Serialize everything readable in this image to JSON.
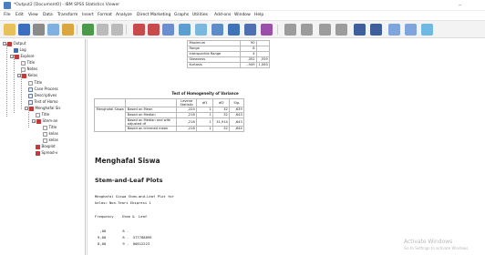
{
  "window": {
    "title": "*Output2 [Document0] - IBM SPSS Statistics Viewer",
    "minimize": "–",
    "maximize": "☐"
  },
  "menu": [
    "File",
    "Edit",
    "View",
    "Data",
    "Transform",
    "Insert",
    "Format",
    "Analyze",
    "Direct Marketing",
    "Graphs",
    "Utilities",
    "Add-ons",
    "Window",
    "Help"
  ],
  "outline": {
    "nodes": [
      {
        "label": "Output",
        "toggle": "−"
      },
      {
        "label": "Log",
        "toggle": ""
      },
      {
        "label": "Explore",
        "toggle": "−"
      },
      {
        "label": "Title",
        "toggle": ""
      },
      {
        "label": "Notes",
        "toggle": ""
      },
      {
        "label": "Kelas",
        "toggle": "−"
      },
      {
        "label": "Title",
        "toggle": ""
      },
      {
        "label": "Case Process",
        "toggle": ""
      },
      {
        "label": "Descriptives",
        "toggle": ""
      },
      {
        "label": "Test of Homo",
        "toggle": ""
      },
      {
        "label": "Menghafal Sis",
        "toggle": "−"
      },
      {
        "label": "Title",
        "toggle": ""
      },
      {
        "label": "Stem-an",
        "toggle": "−"
      },
      {
        "label": "Title",
        "toggle": ""
      },
      {
        "label": "kelas",
        "toggle": ""
      },
      {
        "label": "kelas",
        "toggle": ""
      },
      {
        "label": "Boxplot",
        "toggle": ""
      },
      {
        "label": "Spread-v",
        "toggle": ""
      }
    ]
  },
  "descriptives_tail": {
    "rows": [
      {
        "label": "Maximum",
        "value": "90",
        "se": ""
      },
      {
        "label": "Range",
        "value": "8",
        "se": ""
      },
      {
        "label": "Interquartile Range",
        "value": "4",
        "se": ""
      },
      {
        "label": "Skewness",
        "value": ",352",
        "se": ",559"
      },
      {
        "label": "Kurtosis",
        "value": "-,949",
        "se": "1,063"
      }
    ]
  },
  "homogeneity": {
    "title": "Test of Homogeneity of Variance",
    "headers": [
      "",
      "",
      "Levene Statistic",
      "df1",
      "df2",
      "Sig."
    ],
    "group_label": "Menghafal Siswa",
    "rows": [
      {
        "basis": "Based on Mean",
        "stat": ",224",
        "df1": "1",
        "df2": "32",
        "sig": ",639"
      },
      {
        "basis": "Based on Median",
        "stat": ",218",
        "df1": "1",
        "df2": "32",
        "sig": ",643"
      },
      {
        "basis": "Based on Median and with adjusted df",
        "stat": ",218",
        "df1": "1",
        "df2": "31,914",
        "sig": ",643"
      },
      {
        "basis": "Based on trimmed mean",
        "stat": ",218",
        "df1": "1",
        "df2": "32",
        "sig": ",644"
      }
    ]
  },
  "sections": {
    "menghafal": "Menghafal Siswa",
    "stem_leaf": "Stem-and-Leaf Plots"
  },
  "stem_leaf_text": {
    "line1": "Menghafal Siswa Stem-and-Leaf Plot for",
    "line2": "kelas= Non-Teori Ekspresi 1",
    "header": "Frequency    Stem &  Leaf",
    "rows": [
      " ,00        8 .",
      "9,00        8 .  577788899",
      "8,00        9 .  00012223"
    ]
  },
  "watermark": {
    "line1": "Activate Windows",
    "line2": "Go to Settings to activate Windows."
  },
  "colors": {
    "toolbar_bg": "#f3f3f3",
    "accent": "#4a7fc1"
  }
}
